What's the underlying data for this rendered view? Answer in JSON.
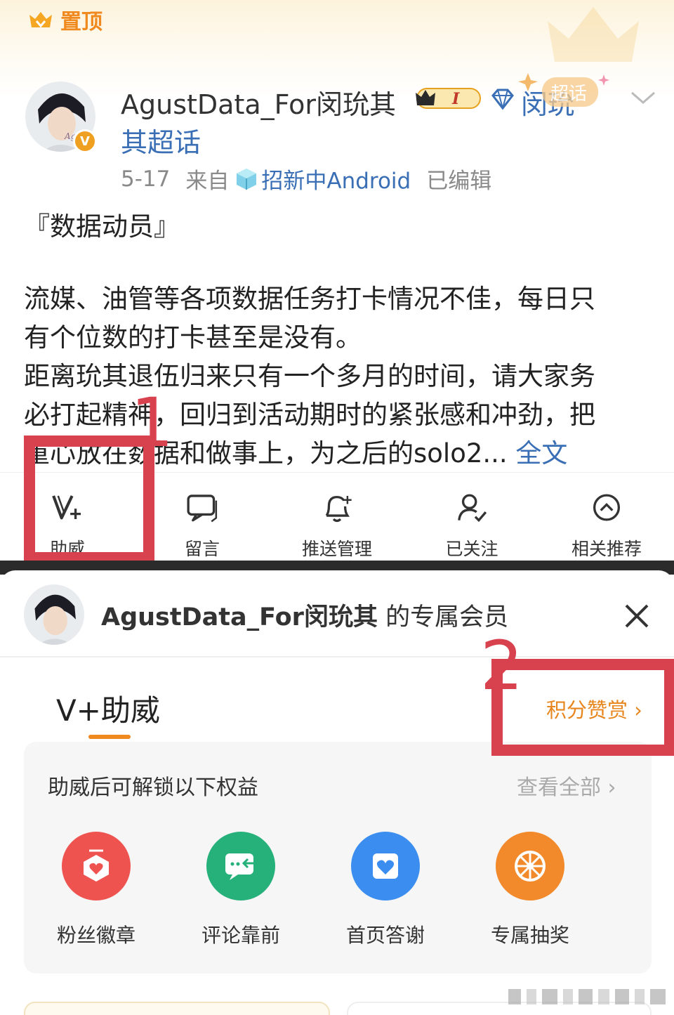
{
  "pin": {
    "label": "置顶"
  },
  "post": {
    "author": "AgustData_For闵玧其",
    "topic_line1": "闵玧",
    "topic_line2": "其超话",
    "level_badge": "I",
    "chaohua_tag": "超话",
    "date": "5-17",
    "from_label": "来自",
    "source": "招新中Android",
    "edited": "已编辑",
    "title": "『数据动员』",
    "body_lines": [
      "流媒、油管等各项数据任务打卡情况不佳，每日只",
      "有个位数的打卡甚至是没有。",
      "距离玧其退伍归来只有一个多月的时间，请大家务",
      "必打起精神，回归到活动期时的紧张感和冲劲，把",
      "重心放在数据和做事上，为之后的solo2..."
    ],
    "full_text_link": "全文"
  },
  "actions": [
    {
      "label": "助威",
      "icon": "v-plus-icon"
    },
    {
      "label": "留言",
      "icon": "comment-icon"
    },
    {
      "label": "推送管理",
      "icon": "bell-plus-icon"
    },
    {
      "label": "已关注",
      "icon": "user-check-icon"
    },
    {
      "label": "相关推荐",
      "icon": "chevron-up-circle-icon"
    }
  ],
  "annotations": {
    "one": "1",
    "two": "2",
    "color": "#d8424f"
  },
  "sheet": {
    "owner": "AgustData_For闵玧其",
    "suffix": "的专属会员",
    "tab": "V+助威",
    "points_reward": "积分赞赏 ›",
    "benefits_hint": "助威后可解锁以下权益",
    "view_all": "查看全部 ›",
    "benefits": [
      {
        "label": "粉丝徽章",
        "icon": "fan-badge-icon",
        "color": "#ef5350"
      },
      {
        "label": "评论靠前",
        "icon": "comment-top-icon",
        "color": "#26b07a"
      },
      {
        "label": "首页答谢",
        "icon": "heart-card-icon",
        "color": "#3b8ef0"
      },
      {
        "label": "专属抽奖",
        "icon": "lottery-wheel-icon",
        "color": "#f2892b"
      }
    ]
  },
  "colors": {
    "accent": "#f08a1e",
    "link": "#3a6fb5"
  }
}
